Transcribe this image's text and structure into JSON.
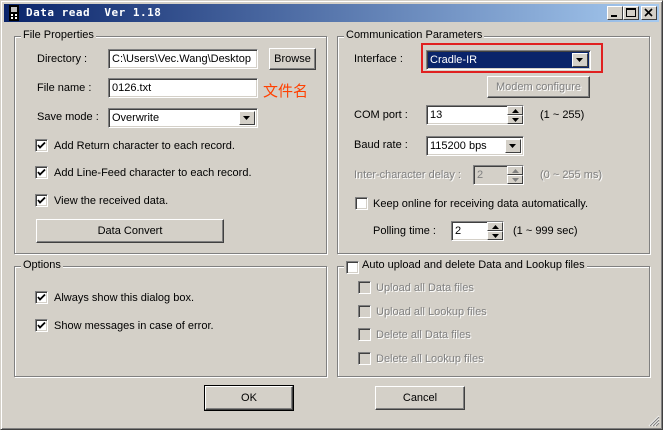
{
  "window": {
    "title": "Data read  Ver 1.18"
  },
  "file_properties": {
    "legend": "File Properties",
    "directory_label": "Directory :",
    "directory_value": "C:\\Users\\Vec.Wang\\Desktop",
    "browse_label": "Browse",
    "file_name_label": "File name :",
    "file_name_value": "0126.txt",
    "file_name_annotation": "文件名",
    "save_mode_label": "Save mode :",
    "save_mode_value": "Overwrite",
    "add_return_label": "Add Return character to each record.",
    "add_return_checked": true,
    "add_linefeed_label": "Add Line-Feed character to each record.",
    "add_linefeed_checked": true,
    "view_received_label": "View the received data.",
    "view_received_checked": true,
    "data_convert_label": "Data Convert"
  },
  "communication": {
    "legend": "Communication Parameters",
    "interface_label": "Interface :",
    "interface_value": "Cradle-IR",
    "modem_configure_label": "Modem configure",
    "com_port_label": "COM port :",
    "com_port_value": "13",
    "com_port_range": "(1 ~ 255)",
    "baud_rate_label": "Baud rate :",
    "baud_rate_value": "115200 bps",
    "inter_char_delay_label": "Inter-character delay :",
    "inter_char_delay_value": "2",
    "inter_char_delay_range": "(0 ~ 255 ms)",
    "keep_online_label": "Keep online for receiving data automatically.",
    "keep_online_checked": false,
    "polling_time_label": "Polling time :",
    "polling_time_value": "2",
    "polling_time_range": "(1 ~ 999 sec)"
  },
  "options": {
    "legend": "Options",
    "always_show_label": "Always show this dialog box.",
    "always_show_checked": true,
    "show_messages_label": "Show messages in case of error.",
    "show_messages_checked": true
  },
  "auto_upload": {
    "legend": "Auto upload and delete Data and Lookup files",
    "checked": false,
    "upload_data_label": "Upload all Data files",
    "upload_lookup_label": "Upload all Lookup files",
    "delete_data_label": "Delete all Data files",
    "delete_lookup_label": "Delete all Lookup files"
  },
  "buttons": {
    "ok_label": "OK",
    "cancel_label": "Cancel"
  },
  "colors": {
    "title_bar_start": "#0a246a",
    "title_bar_end": "#a6caf0",
    "highlight_box": "#e02020",
    "annotation_text": "#ff4000"
  }
}
